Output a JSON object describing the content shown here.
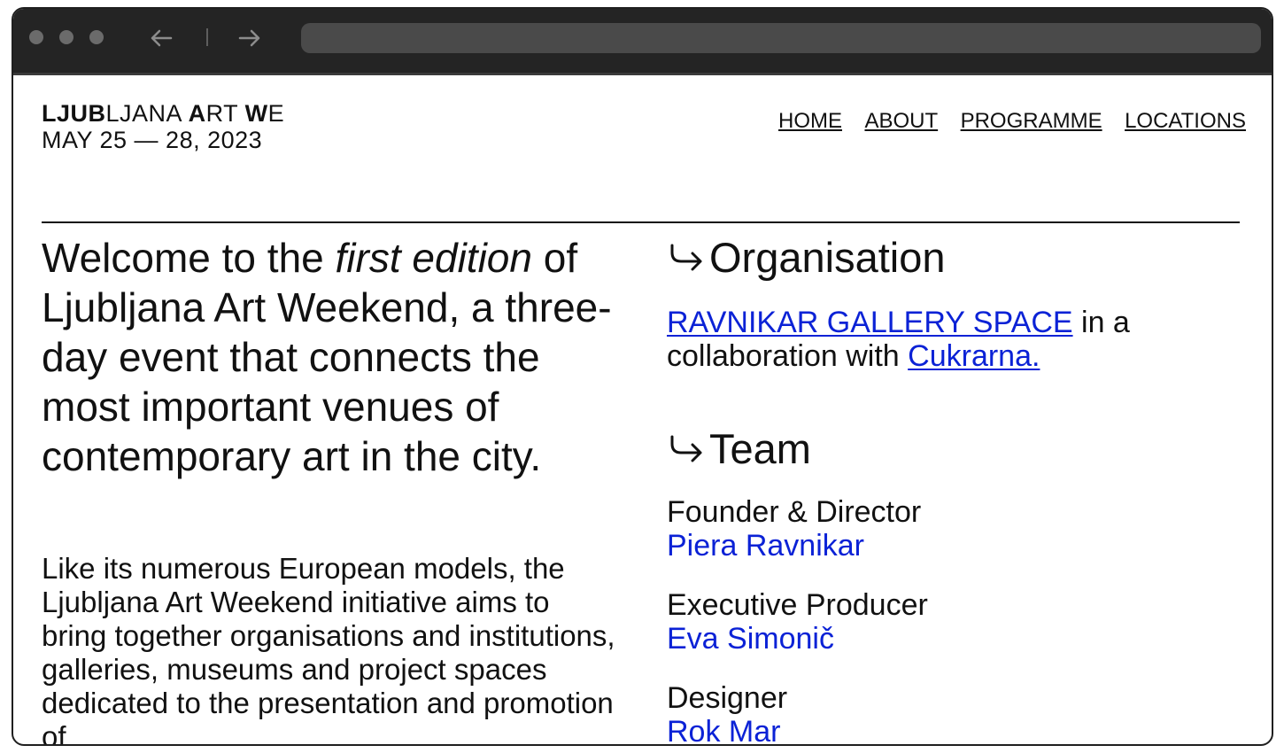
{
  "site": {
    "logo_parts": [
      "LJUB",
      "LJANA ",
      "A",
      "RT ",
      "W",
      "E"
    ],
    "dates": "MAY 25 — 28, 2023"
  },
  "nav": [
    "HOME",
    "ABOUT",
    "PROGRAMME",
    "LOCATIONS"
  ],
  "intro": {
    "before_italic": "Welcome to the ",
    "italic": "first edition",
    "after_italic": " of Ljubljana Art Weekend, a three-day event that connects the most important venues of contemporary art in the city."
  },
  "body": "Like its numerous European models, the Ljubljana Art Weekend initiative aims to bring together organisations and institutions, galleries, museums and project spaces dedicated to the presentation and promotion of",
  "organisation": {
    "heading": "Organisation",
    "link1": "RAVNIKAR GALLERY SPACE",
    "text1": " in a collaboration with ",
    "link2": "Cukrarna."
  },
  "team": {
    "heading": "Team",
    "members": [
      {
        "role": "Founder & Director",
        "name": "Piera Ravnikar"
      },
      {
        "role": "Executive Producer",
        "name": "Eva Simonič"
      },
      {
        "role": "Designer",
        "name": "Rok Mar"
      }
    ]
  },
  "icons": {
    "back": "arrow-left-icon",
    "forward": "arrow-right-icon",
    "section": "turn-right-arrow-icon"
  },
  "colors": {
    "link": "#0b22d6",
    "chrome": "#242424"
  }
}
